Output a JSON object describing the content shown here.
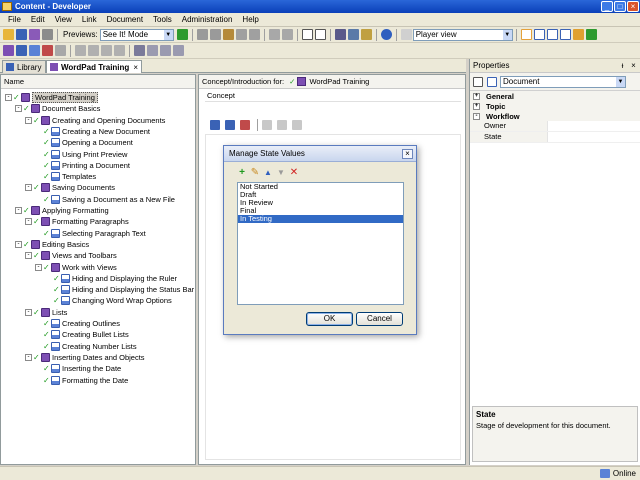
{
  "window": {
    "title": "Content - Developer",
    "minimize": "_",
    "maximize": "□",
    "close": "×"
  },
  "menu": [
    "File",
    "Edit",
    "View",
    "Link",
    "Document",
    "Tools",
    "Administration",
    "Help"
  ],
  "toolbar": {
    "previews_label": "Previews:",
    "preview_mode": "See It! Mode",
    "view_mode": "Player view"
  },
  "tabs": [
    {
      "label": "Library"
    },
    {
      "label": "WordPad Training"
    }
  ],
  "tab_close": "×",
  "tree": {
    "header": "Name",
    "nodes": [
      {
        "label": "WordPad Training",
        "level": 0,
        "type": "book",
        "expander": "-",
        "selected": true
      },
      {
        "label": "Document Basics",
        "level": 1,
        "type": "book",
        "expander": "-"
      },
      {
        "label": "Creating and Opening Documents",
        "level": 2,
        "type": "book",
        "expander": "-"
      },
      {
        "label": "Creating a New Document",
        "level": 3,
        "type": "page"
      },
      {
        "label": "Opening a Document",
        "level": 3,
        "type": "page"
      },
      {
        "label": "Using Print Preview",
        "level": 3,
        "type": "page"
      },
      {
        "label": "Printing a Document",
        "level": 3,
        "type": "page"
      },
      {
        "label": "Templates",
        "level": 3,
        "type": "page"
      },
      {
        "label": "Saving Documents",
        "level": 2,
        "type": "book",
        "expander": "-"
      },
      {
        "label": "Saving a Document as a New File",
        "level": 3,
        "type": "page"
      },
      {
        "label": "Applying Formatting",
        "level": 1,
        "type": "book",
        "expander": "-"
      },
      {
        "label": "Formatting Paragraphs",
        "level": 2,
        "type": "book",
        "expander": "-"
      },
      {
        "label": "Selecting Paragraph Text",
        "level": 3,
        "type": "page"
      },
      {
        "label": "Editing Basics",
        "level": 1,
        "type": "book",
        "expander": "-"
      },
      {
        "label": "Views and Toolbars",
        "level": 2,
        "type": "book",
        "expander": "-"
      },
      {
        "label": "Work with Views",
        "level": 3,
        "type": "book",
        "expander": "-"
      },
      {
        "label": "Hiding and Displaying the Ruler",
        "level": 4,
        "type": "page"
      },
      {
        "label": "Hiding and Displaying the Status Bar",
        "level": 4,
        "type": "page"
      },
      {
        "label": "Changing Word Wrap Options",
        "level": 4,
        "type": "page"
      },
      {
        "label": "Lists",
        "level": 2,
        "type": "book",
        "expander": "-"
      },
      {
        "label": "Creating Outlines",
        "level": 3,
        "type": "page"
      },
      {
        "label": "Creating Bullet Lists",
        "level": 3,
        "type": "page"
      },
      {
        "label": "Creating Number Lists",
        "level": 3,
        "type": "page"
      },
      {
        "label": "Inserting Dates and Objects",
        "level": 2,
        "type": "book",
        "expander": "-"
      },
      {
        "label": "Inserting the Date",
        "level": 3,
        "type": "page"
      },
      {
        "label": "Formatting the Date",
        "level": 3,
        "type": "page"
      }
    ]
  },
  "center": {
    "header_prefix": "Concept/Introduction for:",
    "header_title": "WordPad Training",
    "section_label": "Concept"
  },
  "properties": {
    "title": "Properties",
    "pin": "ᵻ",
    "close": "×",
    "object": "Document",
    "categories": [
      {
        "name": "General",
        "expander": "+",
        "rows": []
      },
      {
        "name": "Topic",
        "expander": "+",
        "rows": []
      },
      {
        "name": "Workflow",
        "expander": "-",
        "rows": [
          {
            "key": "Owner",
            "value": ""
          },
          {
            "key": "State",
            "value": ""
          }
        ]
      }
    ],
    "desc_title": "State",
    "desc_text": "Stage of development for this document."
  },
  "status": {
    "online": "Online"
  },
  "dialog": {
    "title": "Manage State Values",
    "close": "×",
    "tools": {
      "add": "+",
      "edit": "✎",
      "up": "▲",
      "down": "▼",
      "delete": "✕"
    },
    "items": [
      {
        "label": "Not Started",
        "selected": false
      },
      {
        "label": "Draft",
        "selected": false
      },
      {
        "label": "In Review",
        "selected": false
      },
      {
        "label": "Final",
        "selected": false
      },
      {
        "label": "In Testing",
        "selected": true
      }
    ],
    "ok_label": "OK",
    "cancel_label": "Cancel"
  },
  "colors": {
    "check": "#1f9a1f",
    "book": "#7d4fb3",
    "selection": "#316ac5",
    "titlebar": "#0a3fb8"
  }
}
